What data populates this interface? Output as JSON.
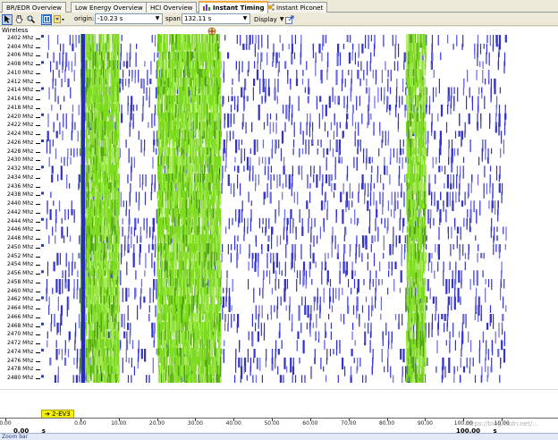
{
  "tabs": [
    {
      "label": "BR/EDR Overview",
      "active": false
    },
    {
      "label": "Low Energy Overview",
      "active": false
    },
    {
      "label": "HCI Overview",
      "active": false
    },
    {
      "label": "Instant Timing",
      "active": true
    },
    {
      "label": "Instant Piconet",
      "active": false
    }
  ],
  "toolbar": {
    "origin_label": "origin:",
    "origin_value": "-10.23 s",
    "span_label": "span:",
    "span_value": "132.11 s",
    "display_label": "Display"
  },
  "legend": {
    "title": "Wireless"
  },
  "channels": [
    "2402 Mhz",
    "2404 Mhz",
    "2406 Mhz",
    "2408 Mhz",
    "2410 Mhz",
    "2412 Mhz",
    "2414 Mhz",
    "2416 Mhz",
    "2418 Mhz",
    "2420 Mhz",
    "2422 Mhz",
    "2424 Mhz",
    "2426 Mhz",
    "2428 Mhz",
    "2430 Mhz",
    "2432 Mhz",
    "2434 Mhz",
    "2436 Mhz",
    "2438 Mhz",
    "2440 Mhz",
    "2442 Mhz",
    "2444 Mhz",
    "2446 Mhz",
    "2448 Mhz",
    "2450 Mhz",
    "2452 Mhz",
    "2454 Mhz",
    "2456 Mhz",
    "2458 Mhz",
    "2460 Mhz",
    "2462 Mhz",
    "2464 Mhz",
    "2466 Mhz",
    "2468 Mhz",
    "2470 Mhz",
    "2472 Mhz",
    "2474 Mhz",
    "2476 Mhz",
    "2478 Mhz",
    "2480 Mhz"
  ],
  "chart_data": {
    "type": "heatmap",
    "title": "",
    "xlabel": "s",
    "ylabel": "",
    "xlim": [
      -10.23,
      121.88
    ],
    "x_ticks": [
      -10,
      0,
      10,
      20,
      30,
      40,
      50,
      60,
      70,
      80,
      90,
      100,
      110
    ],
    "x_tick_labels": [
      "0.00",
      "0.00",
      "10.00",
      "20.00",
      "30.00",
      "40.00",
      "50.00",
      "60.00",
      "70.00",
      "80.00",
      "90.00",
      "100.00",
      "10.00"
    ],
    "series": [
      {
        "color": "#3333cc",
        "density": "sparse",
        "ranges": [
          [
            -10,
            111
          ]
        ]
      },
      {
        "color": "#7ddc1f",
        "density": "dense",
        "ranges": [
          [
            0,
            10
          ],
          [
            20,
            36.5
          ],
          [
            85,
            90
          ]
        ]
      },
      {
        "color": "#2a2ac0",
        "density": "solid-band",
        "ranges": [
          [
            0.2,
            1.2
          ]
        ]
      }
    ]
  },
  "axis": {
    "big_left": "0.00",
    "big_left_unit": "s",
    "big_right": "100.00",
    "big_right_unit": "s"
  },
  "marker": {
    "label": "2-EV3"
  },
  "zoombar": {
    "label": "Zoom bar"
  },
  "watermark": "https://blog.csdn.net/..."
}
